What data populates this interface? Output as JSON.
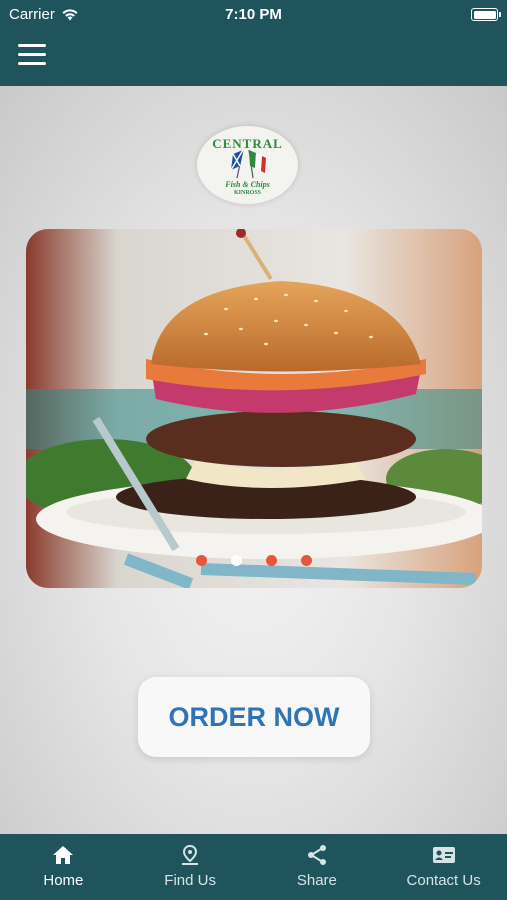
{
  "status_bar": {
    "carrier": "Carrier",
    "time": "7:10 PM"
  },
  "nav": {
    "menu_icon": "hamburger-menu-icon"
  },
  "logo": {
    "line1": "CENTRAL",
    "line2": "Fish & Chips",
    "line3": "KINROSS"
  },
  "carousel": {
    "slide_count": 4,
    "active_index": 1
  },
  "order_button": {
    "label": "ORDER NOW"
  },
  "tabs": [
    {
      "label": "Home",
      "icon": "home-icon",
      "active": true
    },
    {
      "label": "Find Us",
      "icon": "location-pin-icon",
      "active": false
    },
    {
      "label": "Share",
      "icon": "share-icon",
      "active": false
    },
    {
      "label": "Contact Us",
      "icon": "contact-card-icon",
      "active": false
    }
  ],
  "colors": {
    "bar": "#1f545c",
    "accent_blue": "#2f74b5",
    "dot": "#e8553e"
  }
}
